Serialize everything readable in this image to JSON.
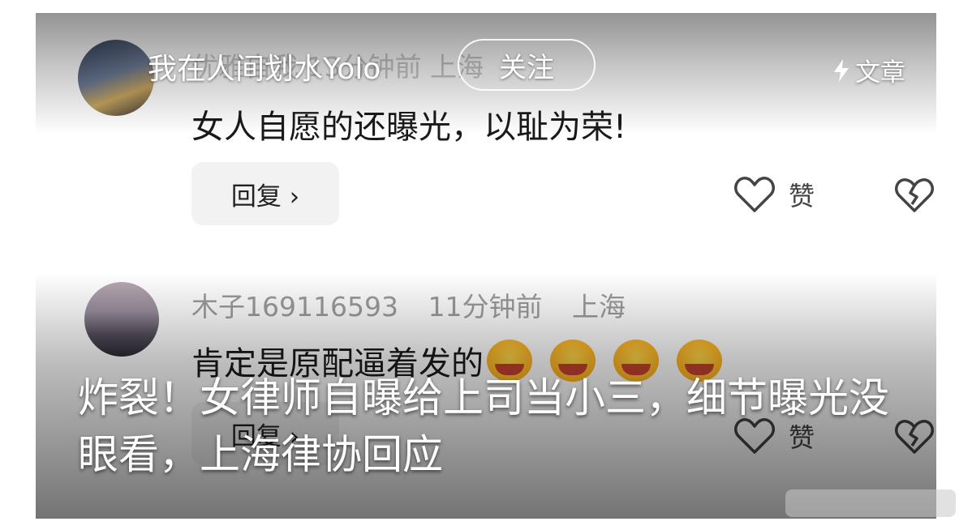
{
  "header": {
    "username": "我在人间划水Yolo",
    "follow_label": "关注",
    "article_label": "文章"
  },
  "comments": [
    {
      "meta_faded": "优雅自我 13分钟前 上海",
      "text": "女人自愿的还曝光，以耻为荣!",
      "reply_label": "回复 ›",
      "like_label": "赞"
    },
    {
      "username": "木子169116593",
      "time": "11分钟前",
      "location": "上海",
      "text": "肯定是原配逼着发的",
      "reply_label": "回复 ›",
      "like_label": "赞"
    }
  ],
  "headline": "炸裂！女律师自曝给上司当小三，细节曝光没眼看，上海律协回应",
  "icons": [
    "heart-outline-icon",
    "broken-heart-icon",
    "lightning-icon",
    "laughing-emoji-icon"
  ]
}
